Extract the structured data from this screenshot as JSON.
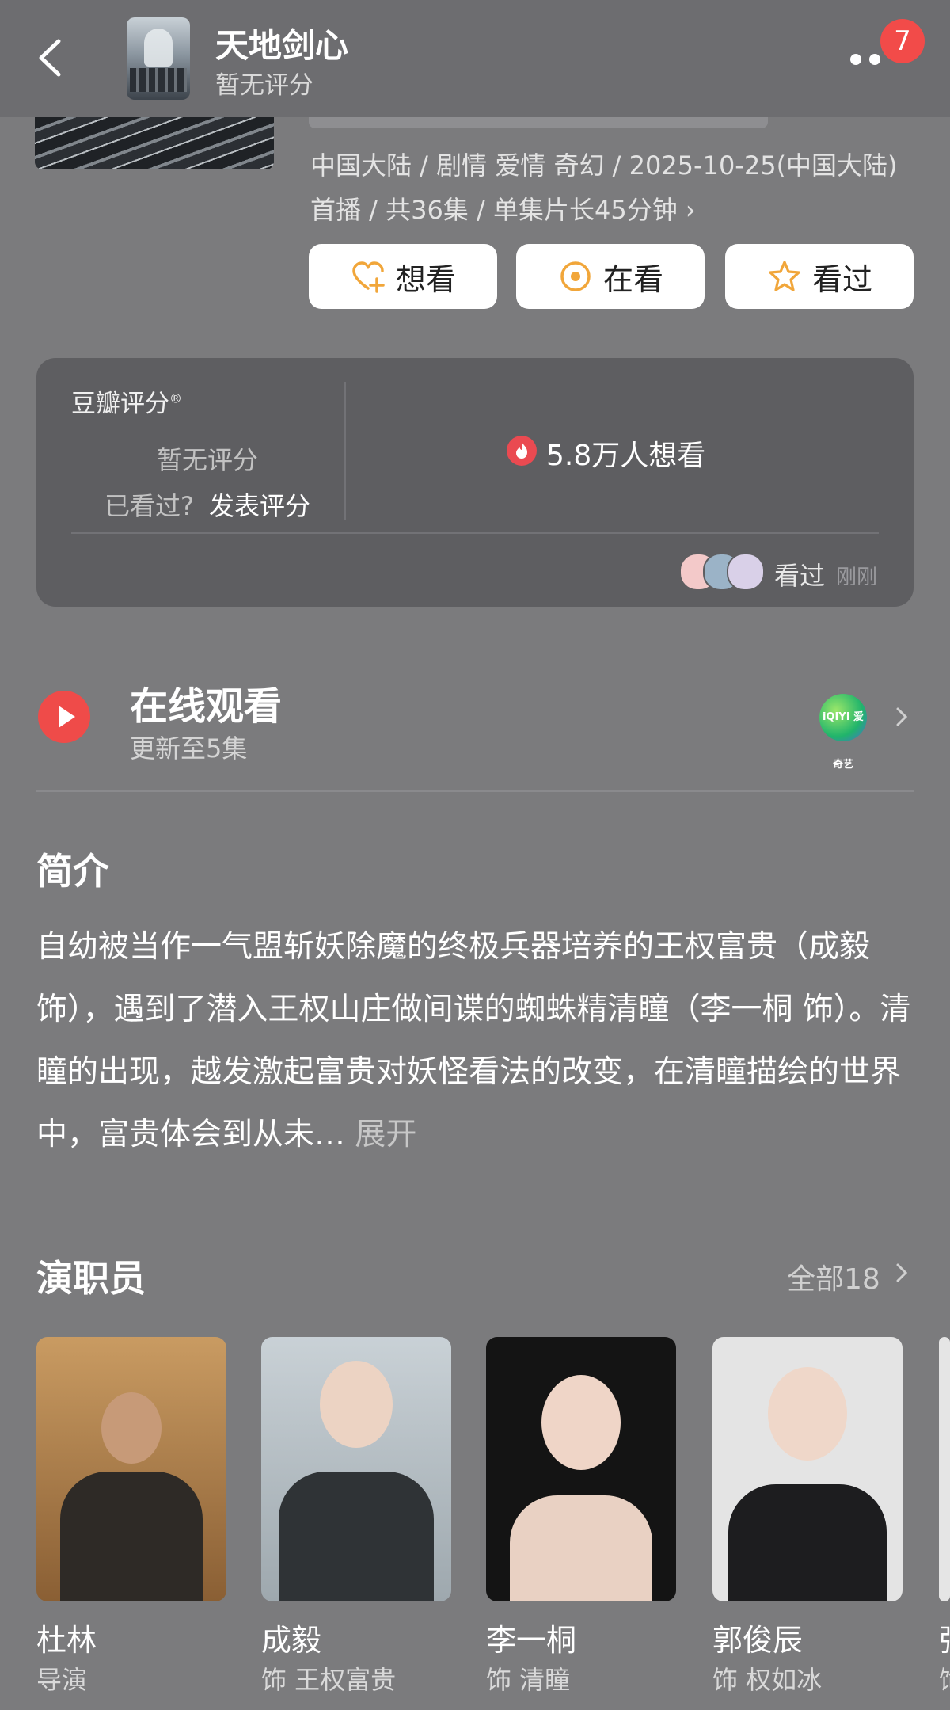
{
  "nav": {
    "title": "天地剑心",
    "subtitle": "暂无评分",
    "notification_count": "7"
  },
  "meta": {
    "line1": "中国大陆 / 剧情 爱情 奇幻 / 2025-10-25(中国大陆)",
    "line2": "首播 / 共36集 / 单集片长45分钟 ›"
  },
  "actions": [
    {
      "label": "想看",
      "icon": "heart-plus-icon"
    },
    {
      "label": "在看",
      "icon": "target-circle-icon"
    },
    {
      "label": "看过",
      "icon": "star-icon"
    }
  ],
  "rating": {
    "label": "豆瓣评分",
    "mark": "®",
    "no_rating": "暂无评分",
    "seen_prompt": "已看过?",
    "post_rating": "发表评分",
    "want_count": "5.8万人想看",
    "watched_label": "看过",
    "watched_time": "刚刚"
  },
  "online": {
    "title": "在线观看",
    "subtitle": "更新至5集",
    "platform_logo": "iQIYI 爱奇艺"
  },
  "intro": {
    "heading": "简介",
    "text": "自幼被当作一气盟斩妖除魔的终极兵器培养的王权富贵（成毅 饰），遇到了潜入王权山庄做间谍的蜘蛛精清瞳（李一桐 饰）。清瞳的出现，越发激起富贵对妖怪看法的改变，在清瞳描绘的世界中，富贵体会到从未…",
    "more": "展开"
  },
  "cast": {
    "heading": "演职员",
    "all_label": "全部18",
    "members": [
      {
        "name": "杜林",
        "role": "导演"
      },
      {
        "name": "成毅",
        "role": "饰 王权富贵"
      },
      {
        "name": "李一桐",
        "role": "饰 清瞳"
      },
      {
        "name": "郭俊辰",
        "role": "饰 权如冰"
      },
      {
        "name": "張",
        "role": "饰"
      }
    ]
  },
  "colors": {
    "accent_red": "#ef4b49",
    "badge_red": "#f24b49",
    "background": "#7b7b7d",
    "card": "#5e5e61"
  }
}
